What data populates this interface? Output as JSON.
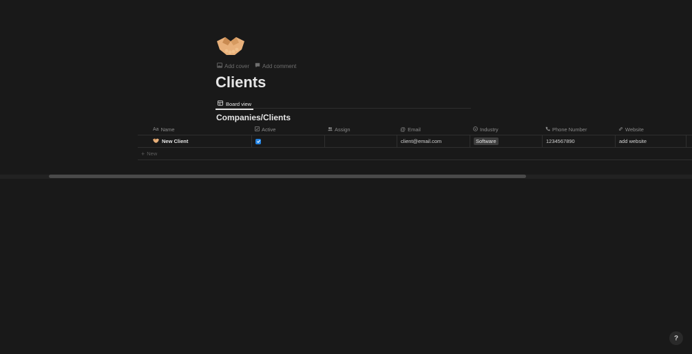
{
  "page": {
    "title": "Clients",
    "icon": "handshake-icon",
    "add_cover": "Add cover",
    "add_comment": "Add comment"
  },
  "tabs": [
    {
      "label": "Board view",
      "icon": "table-icon",
      "active": true
    }
  ],
  "database": {
    "title": "Companies/Clients",
    "columns": [
      {
        "key": "name",
        "label": "Name",
        "icon": "text-aa-icon"
      },
      {
        "key": "active",
        "label": "Active",
        "icon": "checkbox-icon"
      },
      {
        "key": "assign",
        "label": "Assign",
        "icon": "people-icon"
      },
      {
        "key": "email",
        "label": "Email",
        "icon": "at-icon"
      },
      {
        "key": "industry",
        "label": "Industry",
        "icon": "select-icon"
      },
      {
        "key": "phone",
        "label": "Phone Number",
        "icon": "phone-icon"
      },
      {
        "key": "website",
        "label": "Website",
        "icon": "link-icon"
      }
    ],
    "rows": [
      {
        "name": "New Client",
        "active": true,
        "assign": "",
        "email": "client@email.com",
        "industry": "Software",
        "phone": "1234567890",
        "website": "add website"
      }
    ],
    "new_label": "New"
  },
  "help": {
    "label": "?"
  },
  "colors": {
    "background": "#191919",
    "accent": "#2383e2",
    "tag_bg": "#3d3d3d"
  }
}
